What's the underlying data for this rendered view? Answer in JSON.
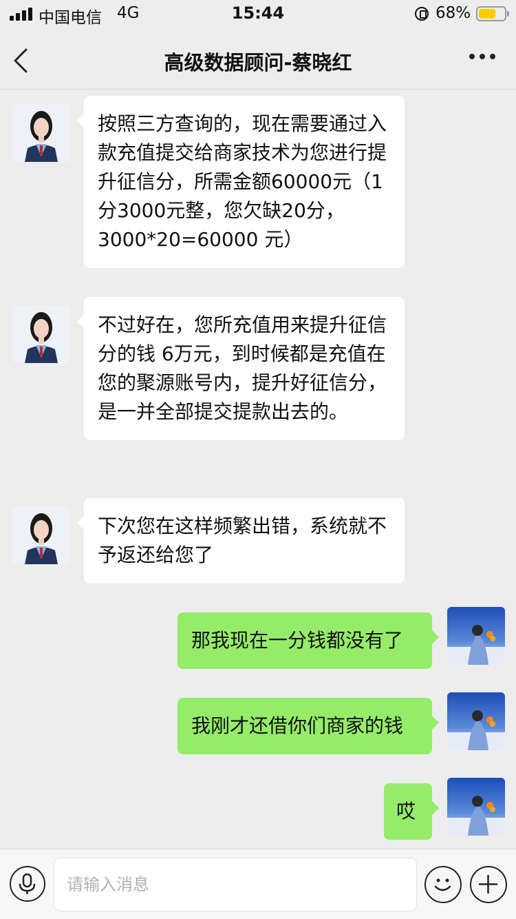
{
  "status_bar": {
    "carrier": "中国电信",
    "network": "4G",
    "time": "15:44",
    "battery_percent": "68%",
    "battery_level": 0.68,
    "battery_color": "#ffcc00"
  },
  "nav": {
    "title": "高级数据顾问-蔡晓红"
  },
  "messages": [
    {
      "side": "incoming",
      "text": "按照三方查询的，现在需要通过入款充值提交给商家技术为您进行提升征信分，所需金额60000元（1分3000元整，您欠缺20分，3000*20=60000 元）"
    },
    {
      "side": "incoming",
      "text": "不过好在，您所充值用来提升征信分的钱 6万元，到时候都是充值在您的聚源账号内，提升好征信分，是一并全部提交提款出去的。"
    },
    {
      "side": "incoming",
      "text": "下次您在这样频繁出错，系统就不予返还给您了"
    },
    {
      "side": "outgoing",
      "text": "那我现在一分钱都没有了"
    },
    {
      "side": "outgoing",
      "text": "我刚才还借你们商家的钱"
    },
    {
      "side": "outgoing",
      "text": "哎"
    }
  ],
  "input": {
    "placeholder": "请输入消息"
  },
  "colors": {
    "background": "#ededed",
    "incoming_bubble": "#ffffff",
    "outgoing_bubble": "#95ec69"
  },
  "icons": {
    "back": "chevron-left-icon",
    "more": "more-icon",
    "voice": "microphone-icon",
    "emoji": "emoji-icon",
    "plus": "plus-icon"
  }
}
